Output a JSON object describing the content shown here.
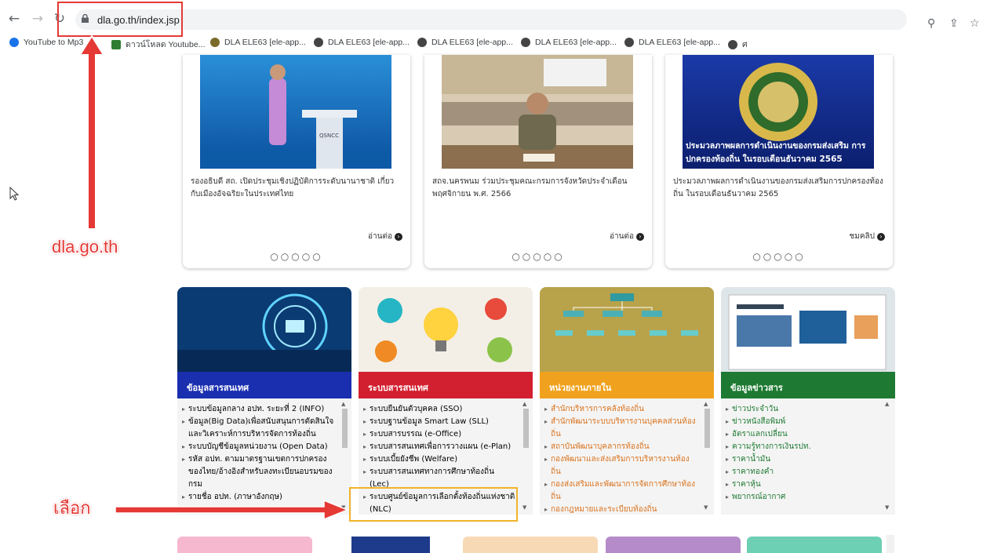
{
  "browser": {
    "url": "dla.go.th/index.jsp",
    "bookmarks": [
      {
        "label": "YouTube to Mp3 ...",
        "color": "#1a73e8"
      },
      {
        "label": "ดาวน์โหลด Youtube...",
        "color": "#2e7d32"
      },
      {
        "label": "DLA ELE63 [ele-app...",
        "color": "#7b6b2a"
      },
      {
        "label": "DLA ELE63 [ele-app...",
        "color": "#444"
      },
      {
        "label": "DLA ELE63 [ele-app...",
        "color": "#444"
      },
      {
        "label": "DLA ELE63 [ele-app...",
        "color": "#444"
      },
      {
        "label": "DLA ELE63 [ele-app...",
        "color": "#444"
      },
      {
        "label": "ศ",
        "color": "#444"
      }
    ]
  },
  "news": [
    {
      "caption": "รองอธิบดี สถ. เปิดประชุมเชิงปฏิบัติการระดับนานาชาติ เกี่ยวกับเมืองอัจฉริยะในประเทศไทย",
      "more": "อ่านต่อ",
      "dots": "○○○○○"
    },
    {
      "caption": "สถจ.นครพนม ร่วมประชุมคณะกรมการจังหวัดประจำเดือน พฤศจิกายน พ.ศ. 2566",
      "more": "อ่านต่อ",
      "dots": "○○○○○"
    },
    {
      "caption": "ประมวลภาพผลการดำเนินงานของกรมส่งเสริมการปกครองท้องถิ่น ในรอบเดือนธันวาคม 2565",
      "more": "ชมคลิป",
      "dots": "○○○○○",
      "img_text": "ประมวลภาพผลการดำเนินงานของกรมส่งเสริม การปกครองท้องถิ่น ในรอบเดือนธันวาคม 2565"
    }
  ],
  "panels": [
    {
      "title": "ข้อมูลสารสนเทศ",
      "color": "#1a2fb0",
      "items": [
        "ระบบข้อมูลกลาง อปท. ระยะที่ 2 (INFO)",
        "ข้อมูล(Big Data)เพื่อสนับสนุนการตัดสินใจ และวิเคราะห์การบริหารจัดการท้องถิ่น",
        "ระบบบัญชีข้อมูลหน่วยงาน (Open Data)",
        "รหัส อปท. ตามมาตรฐานเขตการปกครองของไทย/อ้างอิงสำหรับลงทะเบียนอบรมของกรม",
        "รายชื่อ อปท. (ภาษาอังกฤษ)"
      ]
    },
    {
      "title": "ระบบสารสนเทศ",
      "color": "#d32030",
      "items": [
        "ระบบยืนยันตัวบุคคล (SSO)",
        "ระบบฐานข้อมูล Smart Law (SLL)",
        "ระบบสารบรรณ (e-Office)",
        "ระบบสารสนเทศเพื่อการวางแผน (e-Plan)",
        "ระบบเบี้ยยังชีพ (Welfare)",
        "ระบบสารสนเทศทางการศึกษาท้องถิ่น (Lec)",
        "ระบบศูนย์ข้อมูลการเลือกตั้งท้องถิ่นแห่งชาติ (NLC)"
      ]
    },
    {
      "title": "หน่วยงานภายใน",
      "color": "#f0a21e",
      "items": [
        "สำนักบริหารการคลังท้องถิ่น",
        "สำนักพัฒนาระบบบริหารงานบุคคลส่วนท้องถิ่น",
        "สถาบันพัฒนาบุคลากรท้องถิ่น",
        "กองพัฒนาและส่งเสริมการบริหารงานท้องถิ่น",
        "กองส่งเสริมและพัฒนาการจัดการศึกษาท้องถิ่น",
        "กองกฎหมายและระเบียบท้องถิ่น"
      ]
    },
    {
      "title": "ข้อมูลข่าวสาร",
      "color": "#1e7a32",
      "items": [
        "ข่าวประจำวัน",
        "ข่าวหนังสือพิมพ์",
        "อัตราแลกเปลี่ยน",
        "ความรู้ทางการเงินรปท.",
        "ราคาน้ำมัน",
        "ราคาทองคำ",
        "ราคาหุ้น",
        "พยากรณ์อากาศ"
      ]
    }
  ],
  "annotations": {
    "site": "dla.go.th",
    "choose": "เลือก"
  }
}
